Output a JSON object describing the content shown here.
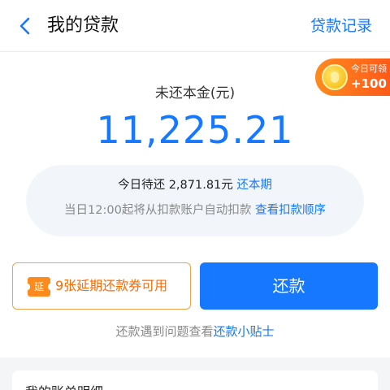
{
  "header": {
    "title": "我的贷款",
    "records_label": "贷款记录"
  },
  "reward": {
    "label": "今日可领",
    "amount": "+100"
  },
  "principal": {
    "label": "未还本金(元)",
    "value": "11,225.21"
  },
  "info": {
    "due_prefix": "今日待还 ",
    "due_amount": "2,871.81元",
    "due_link": "还本期",
    "auto_text": "当日12:00起将从扣款账户自动扣款",
    "order_link": "查看扣款顺序"
  },
  "coupon": {
    "icon_text": "延",
    "label": "9张延期还款券可用"
  },
  "repay_button": "还款",
  "tip": {
    "prefix": "还款遇到问题查看",
    "link": "还款小贴士"
  },
  "bottom": {
    "title": "我的账单明细"
  },
  "colors": {
    "accent": "#1677ff",
    "coupon": "#ff6a00",
    "reward": "#ff5a1a"
  }
}
